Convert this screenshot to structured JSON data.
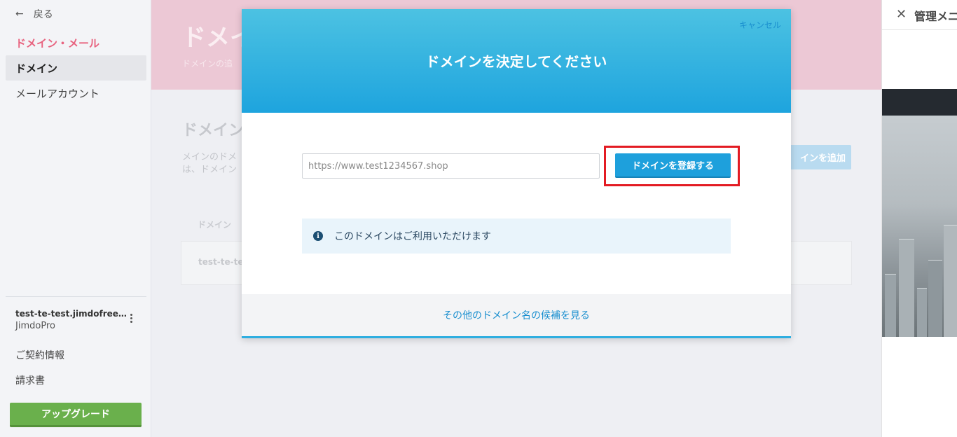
{
  "sidebar": {
    "back_label": "戻る",
    "section_title": "ドメイン・メール",
    "nav_items": [
      {
        "label": "ドメイン",
        "active": true
      },
      {
        "label": "メールアカウント",
        "active": false
      }
    ],
    "site_name": "test-te-test.jimdofree.com",
    "plan": "JimdoPro",
    "links": [
      "ご契約情報",
      "請求書"
    ],
    "upgrade_label": "アップグレード"
  },
  "background": {
    "hero_title": "ドメイン",
    "hero_sub": "ドメインの追",
    "card_title": "ドメイン",
    "card_desc_line1": "メインのドメ",
    "card_desc_line2": "は、ドメイン",
    "add_button": "インを追加",
    "table_header": "ドメイン",
    "table_cell": "test-te-test"
  },
  "right_panel": {
    "title": "管理メニュー"
  },
  "modal": {
    "cancel_label": "キャンセル",
    "title": "ドメインを決定してください",
    "input_value": "https://www.test1234567.shop",
    "register_button": "ドメインを登録する",
    "info_icon": "i",
    "info_text": "このドメインはご利用いただけます",
    "footer_link": "その他のドメイン名の候補を見る"
  },
  "colors": {
    "accent": "#1ea0dc",
    "highlight": "#e31b23",
    "section_title": "#e8637f",
    "upgrade": "#6ab04c"
  }
}
